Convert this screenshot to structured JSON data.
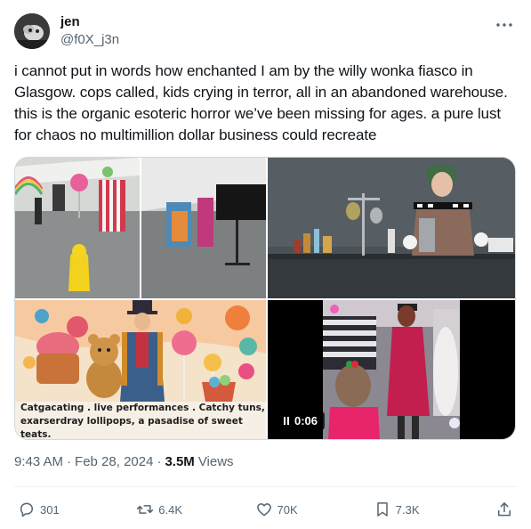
{
  "author": {
    "display_name": "jen",
    "handle": "@f0X_j3n"
  },
  "tweet": {
    "text": "i cannot put in words how enchanted I am by the willy wonka fiasco in Glasgow. cops called, kids crying in terror, all in an abandoned warehouse. this is the organic esoteric horror we’ve been missing for ages. a pure lust for chaos no multimillion dollar business could recreate"
  },
  "media": {
    "poster_caption_line1": "Catgacating  .  live performances  .  Catchy tuns,",
    "poster_caption_line2": "exarserdray lollipops,  a  pasadise of sweet teats.",
    "video_duration": "0:06"
  },
  "meta": {
    "time": "9:43 AM",
    "separator1": "·",
    "date": "Feb 28, 2024",
    "separator2": "·",
    "views_count": "3.5M",
    "views_label": "Views"
  },
  "actions": {
    "replies": "301",
    "reposts": "6.4K",
    "likes": "70K",
    "bookmarks": "7.3K"
  },
  "icons": {
    "more": "more-horizontal-icon",
    "reply": "reply-icon",
    "repost": "repost-icon",
    "like": "heart-icon",
    "bookmark": "bookmark-icon",
    "share": "share-icon",
    "pause": "pause-icon"
  },
  "colors": {
    "text_primary": "#0f1419",
    "text_secondary": "#536471",
    "border": "#cfd9de"
  }
}
